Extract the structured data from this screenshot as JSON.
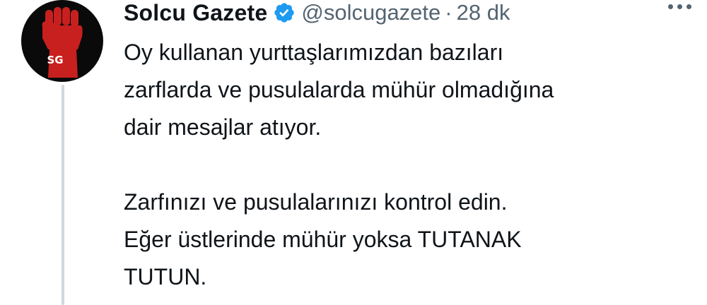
{
  "author": {
    "display_name": "Solcu Gazete",
    "handle": "@solcugazete",
    "separator": "·",
    "timestamp": "28 dk",
    "avatar_text": "SG",
    "verified_icon": "verified-badge-icon",
    "verified_color": "#1d9bf0"
  },
  "tweet": {
    "paragraph_1": [
      "Oy kullanan yurttaşlarımızdan bazıları",
      "zarflarda ve pusulalarda mühür olmadığına",
      "dair mesajlar atıyor."
    ],
    "paragraph_2": [
      "Zarfınızı ve pusulalarınızı kontrol edin.",
      "Eğer üstlerinde mühür yoksa TUTANAK",
      "TUTUN."
    ]
  },
  "colors": {
    "text": "#0f1419",
    "secondary": "#536471",
    "avatar_bg": "#0a0a0a",
    "fist_red": "#c8201e",
    "thread_line": "#cfd9de"
  }
}
